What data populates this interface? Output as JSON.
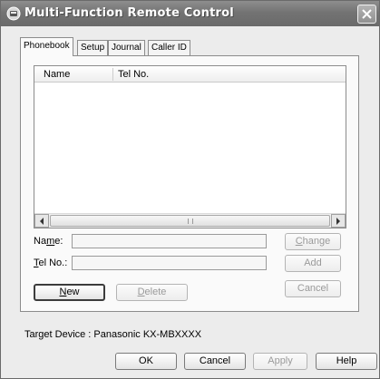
{
  "window": {
    "title": "Multi-Function Remote Control",
    "icon": "app-icon",
    "close_icon": "close-icon"
  },
  "tabs": [
    {
      "label": "Phonebook",
      "active": true
    },
    {
      "label": "Setup",
      "active": false
    },
    {
      "label": "Journal",
      "active": false
    },
    {
      "label": "Caller ID",
      "active": false
    }
  ],
  "phonebook": {
    "columns": [
      "Name",
      "Tel No."
    ],
    "rows": [],
    "name_label_pre": "Na",
    "name_label_mnemonic": "m",
    "name_label_post": "e:",
    "name_value": "",
    "tel_label_mnemonic": "T",
    "tel_label_post": "el No.:",
    "tel_value": "",
    "change_button_mnemonic": "C",
    "change_button_post": "hange",
    "add_button": "Add",
    "cancel_button": "Cancel",
    "new_button_mnemonic": "N",
    "new_button_post": "ew",
    "delete_button_mnemonic": "D",
    "delete_button_post": "elete"
  },
  "footer": {
    "target_device": "Target Device : Panasonic KX-MBXXXX",
    "ok_button": "OK",
    "cancel_button": "Cancel",
    "apply_button": "Apply",
    "help_button": "Help"
  }
}
